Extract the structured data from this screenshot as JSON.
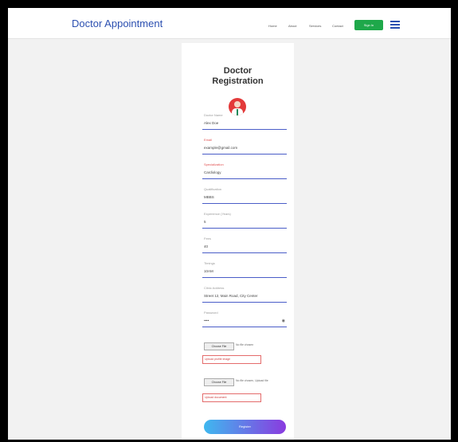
{
  "brand": "Doctor Appointment",
  "nav": [
    "Home",
    "About",
    "Services",
    "Contact"
  ],
  "nav_cta": "Sign In",
  "form": {
    "title_line1": "Doctor",
    "title_line2": "Registration",
    "fields": [
      {
        "label": "Doctor Name",
        "value": "Alex Doe",
        "red": false
      },
      {
        "label": "Email",
        "value": "example@gmail.com",
        "red": true
      },
      {
        "label": "Specialization",
        "value": "Cardiology",
        "red": true
      },
      {
        "label": "Qualification",
        "value": "MBBS",
        "red": false
      },
      {
        "label": "Experience (Years)",
        "value": "5",
        "red": false
      },
      {
        "label": "Fees",
        "value": "40",
        "red": false
      },
      {
        "label": "Timings",
        "value": "10AM",
        "red": false
      },
      {
        "label": "Clinic Address",
        "value": "Street 12, Main Road, City Center",
        "red": false
      },
      {
        "label": "Password",
        "value": "••••",
        "red": false
      }
    ],
    "file1": {
      "button": "Choose File",
      "text": "No file chosen",
      "error": "Upload profile image"
    },
    "file2": {
      "button": "Choose File",
      "text": "No file chosen, Upload file",
      "error": "Upload document"
    },
    "submit": "Register"
  }
}
